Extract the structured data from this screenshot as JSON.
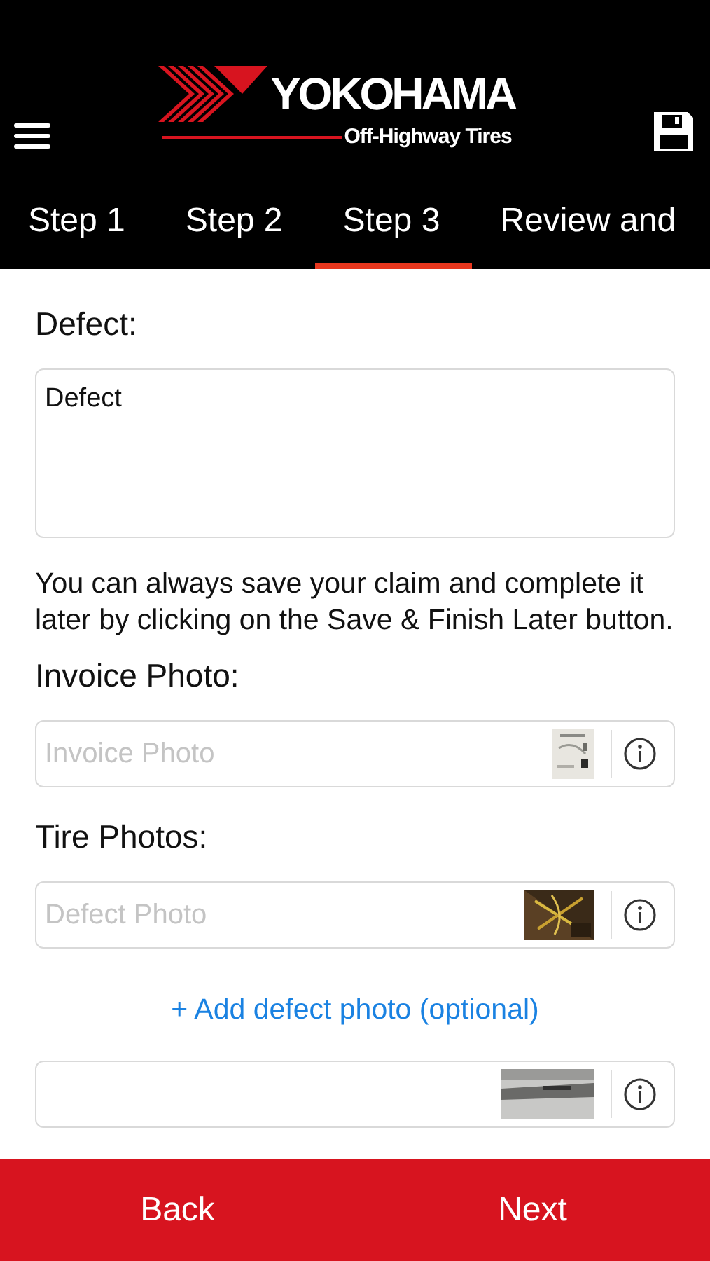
{
  "header": {
    "logo": {
      "wordmark": "YOKOHAMA",
      "tagline": "Off-Highway Tires"
    }
  },
  "tabs": [
    {
      "label": "Step 1",
      "selected": false
    },
    {
      "label": "Step 2",
      "selected": false
    },
    {
      "label": "Step 3",
      "selected": true
    },
    {
      "label": "Review and",
      "selected": false
    }
  ],
  "form": [
    {
      "kind": "label",
      "text": "Defect:"
    },
    {
      "kind": "textarea",
      "value": "Defect"
    },
    {
      "kind": "note",
      "text": "You can always save your claim and complete it later by clicking on the Save & Finish Later button."
    },
    {
      "kind": "label",
      "text": "Invoice Photo:"
    },
    {
      "placeholder": "Invoice Photo",
      "photo": {
        "kind": "picture"
      }
    },
    {
      "kind": "label",
      "text": "Tire Photos:"
    },
    {
      "placeholder": "Defect Photo",
      "photo": {
        "kind": "picture"
      }
    },
    {
      "kind": "link",
      "text": "+ Add defect photo (optional)"
    },
    {
      "photo": {
        "kind": "picture"
      }
    }
  ],
  "footer": {
    "buttons": [
      "Back",
      "Next"
    ]
  }
}
